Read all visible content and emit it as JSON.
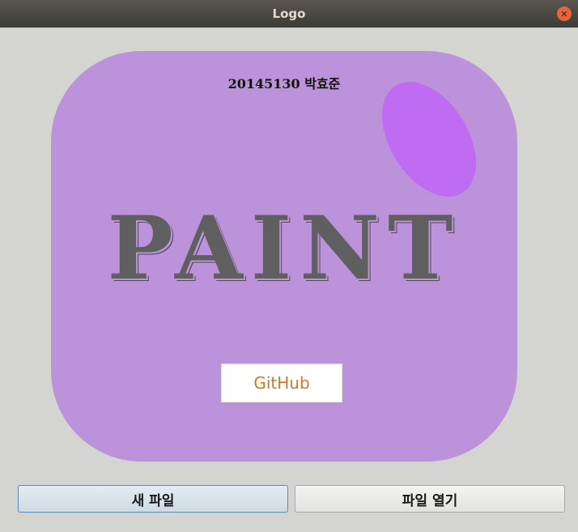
{
  "window": {
    "title": "Logo",
    "close_icon": "close-icon"
  },
  "logo": {
    "student_label": "20145130 박효준",
    "app_name": "PAINT",
    "panel_color": "#bc92da",
    "ellipse_color": "#c06cf2",
    "text_color": "#5f5f60"
  },
  "github_button": {
    "label": "GitHub",
    "color": "#d2772a"
  },
  "actions": {
    "new_file_label": "새 파일",
    "open_file_label": "파일 열기"
  }
}
